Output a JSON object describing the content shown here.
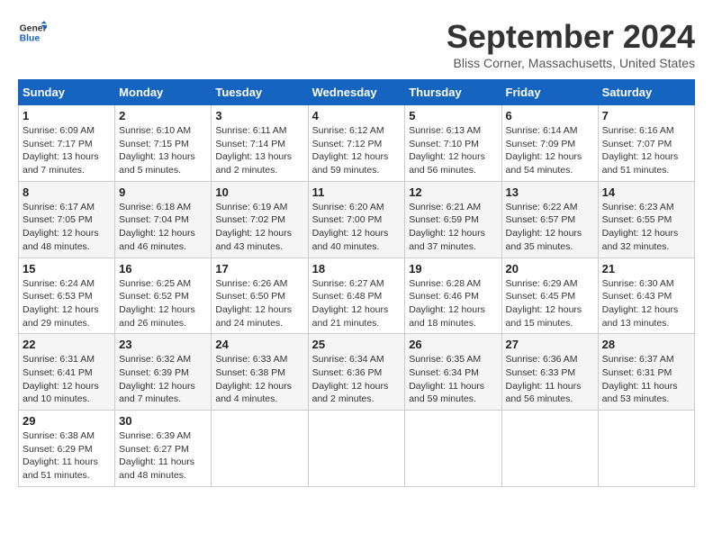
{
  "header": {
    "logo_line1": "General",
    "logo_line2": "Blue",
    "month_title": "September 2024",
    "subtitle": "Bliss Corner, Massachusetts, United States"
  },
  "columns": [
    "Sunday",
    "Monday",
    "Tuesday",
    "Wednesday",
    "Thursday",
    "Friday",
    "Saturday"
  ],
  "weeks": [
    [
      {
        "day": "1",
        "sunrise": "Sunrise: 6:09 AM",
        "sunset": "Sunset: 7:17 PM",
        "daylight": "Daylight: 13 hours and 7 minutes."
      },
      {
        "day": "2",
        "sunrise": "Sunrise: 6:10 AM",
        "sunset": "Sunset: 7:15 PM",
        "daylight": "Daylight: 13 hours and 5 minutes."
      },
      {
        "day": "3",
        "sunrise": "Sunrise: 6:11 AM",
        "sunset": "Sunset: 7:14 PM",
        "daylight": "Daylight: 13 hours and 2 minutes."
      },
      {
        "day": "4",
        "sunrise": "Sunrise: 6:12 AM",
        "sunset": "Sunset: 7:12 PM",
        "daylight": "Daylight: 12 hours and 59 minutes."
      },
      {
        "day": "5",
        "sunrise": "Sunrise: 6:13 AM",
        "sunset": "Sunset: 7:10 PM",
        "daylight": "Daylight: 12 hours and 56 minutes."
      },
      {
        "day": "6",
        "sunrise": "Sunrise: 6:14 AM",
        "sunset": "Sunset: 7:09 PM",
        "daylight": "Daylight: 12 hours and 54 minutes."
      },
      {
        "day": "7",
        "sunrise": "Sunrise: 6:16 AM",
        "sunset": "Sunset: 7:07 PM",
        "daylight": "Daylight: 12 hours and 51 minutes."
      }
    ],
    [
      {
        "day": "8",
        "sunrise": "Sunrise: 6:17 AM",
        "sunset": "Sunset: 7:05 PM",
        "daylight": "Daylight: 12 hours and 48 minutes."
      },
      {
        "day": "9",
        "sunrise": "Sunrise: 6:18 AM",
        "sunset": "Sunset: 7:04 PM",
        "daylight": "Daylight: 12 hours and 46 minutes."
      },
      {
        "day": "10",
        "sunrise": "Sunrise: 6:19 AM",
        "sunset": "Sunset: 7:02 PM",
        "daylight": "Daylight: 12 hours and 43 minutes."
      },
      {
        "day": "11",
        "sunrise": "Sunrise: 6:20 AM",
        "sunset": "Sunset: 7:00 PM",
        "daylight": "Daylight: 12 hours and 40 minutes."
      },
      {
        "day": "12",
        "sunrise": "Sunrise: 6:21 AM",
        "sunset": "Sunset: 6:59 PM",
        "daylight": "Daylight: 12 hours and 37 minutes."
      },
      {
        "day": "13",
        "sunrise": "Sunrise: 6:22 AM",
        "sunset": "Sunset: 6:57 PM",
        "daylight": "Daylight: 12 hours and 35 minutes."
      },
      {
        "day": "14",
        "sunrise": "Sunrise: 6:23 AM",
        "sunset": "Sunset: 6:55 PM",
        "daylight": "Daylight: 12 hours and 32 minutes."
      }
    ],
    [
      {
        "day": "15",
        "sunrise": "Sunrise: 6:24 AM",
        "sunset": "Sunset: 6:53 PM",
        "daylight": "Daylight: 12 hours and 29 minutes."
      },
      {
        "day": "16",
        "sunrise": "Sunrise: 6:25 AM",
        "sunset": "Sunset: 6:52 PM",
        "daylight": "Daylight: 12 hours and 26 minutes."
      },
      {
        "day": "17",
        "sunrise": "Sunrise: 6:26 AM",
        "sunset": "Sunset: 6:50 PM",
        "daylight": "Daylight: 12 hours and 24 minutes."
      },
      {
        "day": "18",
        "sunrise": "Sunrise: 6:27 AM",
        "sunset": "Sunset: 6:48 PM",
        "daylight": "Daylight: 12 hours and 21 minutes."
      },
      {
        "day": "19",
        "sunrise": "Sunrise: 6:28 AM",
        "sunset": "Sunset: 6:46 PM",
        "daylight": "Daylight: 12 hours and 18 minutes."
      },
      {
        "day": "20",
        "sunrise": "Sunrise: 6:29 AM",
        "sunset": "Sunset: 6:45 PM",
        "daylight": "Daylight: 12 hours and 15 minutes."
      },
      {
        "day": "21",
        "sunrise": "Sunrise: 6:30 AM",
        "sunset": "Sunset: 6:43 PM",
        "daylight": "Daylight: 12 hours and 13 minutes."
      }
    ],
    [
      {
        "day": "22",
        "sunrise": "Sunrise: 6:31 AM",
        "sunset": "Sunset: 6:41 PM",
        "daylight": "Daylight: 12 hours and 10 minutes."
      },
      {
        "day": "23",
        "sunrise": "Sunrise: 6:32 AM",
        "sunset": "Sunset: 6:39 PM",
        "daylight": "Daylight: 12 hours and 7 minutes."
      },
      {
        "day": "24",
        "sunrise": "Sunrise: 6:33 AM",
        "sunset": "Sunset: 6:38 PM",
        "daylight": "Daylight: 12 hours and 4 minutes."
      },
      {
        "day": "25",
        "sunrise": "Sunrise: 6:34 AM",
        "sunset": "Sunset: 6:36 PM",
        "daylight": "Daylight: 12 hours and 2 minutes."
      },
      {
        "day": "26",
        "sunrise": "Sunrise: 6:35 AM",
        "sunset": "Sunset: 6:34 PM",
        "daylight": "Daylight: 11 hours and 59 minutes."
      },
      {
        "day": "27",
        "sunrise": "Sunrise: 6:36 AM",
        "sunset": "Sunset: 6:33 PM",
        "daylight": "Daylight: 11 hours and 56 minutes."
      },
      {
        "day": "28",
        "sunrise": "Sunrise: 6:37 AM",
        "sunset": "Sunset: 6:31 PM",
        "daylight": "Daylight: 11 hours and 53 minutes."
      }
    ],
    [
      {
        "day": "29",
        "sunrise": "Sunrise: 6:38 AM",
        "sunset": "Sunset: 6:29 PM",
        "daylight": "Daylight: 11 hours and 51 minutes."
      },
      {
        "day": "30",
        "sunrise": "Sunrise: 6:39 AM",
        "sunset": "Sunset: 6:27 PM",
        "daylight": "Daylight: 11 hours and 48 minutes."
      },
      null,
      null,
      null,
      null,
      null
    ]
  ]
}
